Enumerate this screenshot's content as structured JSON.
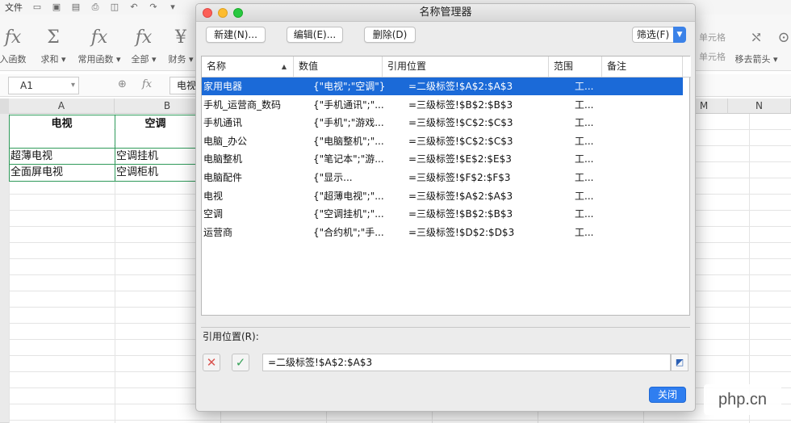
{
  "menubar": {
    "file": "文件"
  },
  "ribbon": {
    "buttons": [
      {
        "label": "入函数",
        "icon": "fx"
      },
      {
        "label": "求和",
        "icon": "Σ"
      },
      {
        "label": "常用函数",
        "icon": "fx"
      },
      {
        "label": "全部",
        "icon": "fx"
      },
      {
        "label": "财务",
        "icon": "¥"
      }
    ],
    "right_top": "单元格",
    "right_bottom": "单元格",
    "remove_arrow": "移去箭头"
  },
  "formulabar": {
    "namebox": "A1",
    "fx": "fx",
    "content": "电视"
  },
  "sheet": {
    "columns": [
      "A",
      "B",
      "M",
      "N"
    ],
    "cells": {
      "a1": "电视",
      "b1": "空调",
      "a3": "超薄电视",
      "b3": "空调挂机",
      "a4": "全面屏电视",
      "b4": "空调柜机"
    }
  },
  "dialog": {
    "title": "名称管理器",
    "buttons": {
      "new": "新建(N)...",
      "edit": "编辑(E)...",
      "delete": "删除(D)",
      "filter": "筛选(F)"
    },
    "columns": {
      "name": "名称",
      "value": "数值",
      "ref": "引用位置",
      "scope": "范围",
      "note": "备注"
    },
    "rows": [
      {
        "name": "家用电器",
        "value": "{\"电视\";\"空调\"}",
        "ref": "=二级标签!$A$2:$A$3",
        "scope": "工..."
      },
      {
        "name": "手机_运营商_数码",
        "value": "{\"手机通讯\";\"...",
        "ref": "=三级标签!$B$2:$B$3",
        "scope": "工..."
      },
      {
        "name": "手机通讯",
        "value": "{\"手机\";\"游戏...",
        "ref": "=三级标签!$C$2:$C$3",
        "scope": "工..."
      },
      {
        "name": "电脑_办公",
        "value": "{\"电脑整机\";\"...",
        "ref": "=三级标签!$C$2:$C$3",
        "scope": "工..."
      },
      {
        "name": "电脑整机",
        "value": "{\"笔记本\";\"游...",
        "ref": "=三级标签!$E$2:$E$3",
        "scope": "工..."
      },
      {
        "name": "电脑配件",
        "value": "{\"显示...",
        "ref": "=三级标签!$F$2:$F$3",
        "scope": "工..."
      },
      {
        "name": "电视",
        "value": "{\"超薄电视\";\"...",
        "ref": "=三级标签!$A$2:$A$3",
        "scope": "工..."
      },
      {
        "name": "空调",
        "value": "{\"空调挂机\";\"...",
        "ref": "=三级标签!$B$2:$B$3",
        "scope": "工..."
      },
      {
        "name": "运营商",
        "value": "{\"合约机\";\"手...",
        "ref": "=三级标签!$D$2:$D$3",
        "scope": "工..."
      }
    ],
    "ref_label": "引用位置(R):",
    "ref_value": "=二级标签!$A$2:$A$3",
    "close": "关闭"
  },
  "watermark": {
    "brand": "php.cn"
  },
  "colors": {
    "selection": "#1b6ad8",
    "accent": "#2f7ef0",
    "cell_border": "#2f9a5a"
  }
}
